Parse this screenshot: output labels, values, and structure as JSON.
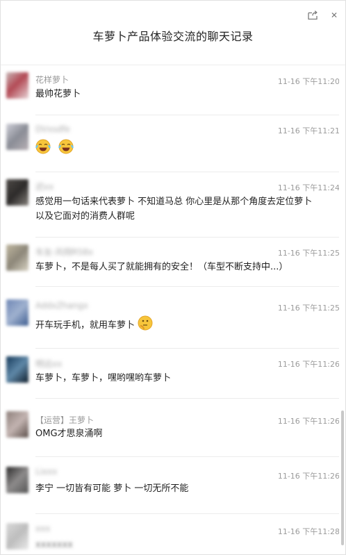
{
  "window": {
    "title": "车萝卜产品体验交流的聊天记录",
    "share_icon": "share-icon",
    "close_label": "✕"
  },
  "messages": [
    {
      "name": "花样萝卜",
      "time": "11-16 下午11:20",
      "text": "最帅花萝卜",
      "name_blur": false,
      "avatar_colors": [
        "#c8b6b6",
        "#b34a55",
        "#e7d3d6"
      ]
    },
    {
      "name": "DVxsdfe",
      "time": "11-16 下午11:21",
      "text": "",
      "emoji": [
        "laugh-cry",
        "laugh-cry"
      ],
      "name_blur": true,
      "avatar_colors": [
        "#cfcfd8",
        "#8a8d96",
        "#b7b0b5"
      ]
    },
    {
      "name": "迟xx",
      "time": "11-16 下午11:24",
      "text": "感觉用一句话来代表萝卜 不知道马总 你心里是从那个角度去定位萝卜以及它面对的消费人群呢",
      "name_blur": true,
      "avatar_colors": [
        "#4e4a47",
        "#2d2b2a",
        "#86817c"
      ]
    },
    {
      "name": "车友-风翔R58x",
      "time": "11-16 下午11:25",
      "text": "车萝卜，不是每人买了就能拥有的安全！（车型不断支持中...）",
      "name_blur": true,
      "avatar_colors": [
        "#bfb7a0",
        "#8d8779",
        "#d8d3c3"
      ]
    },
    {
      "name": "AddxZhangx",
      "time": "11-16 下午11:25",
      "text": "开车玩手机，就用车萝卜",
      "emoji_after": "thinking",
      "name_blur": true,
      "avatar_colors": [
        "#6f87b5",
        "#9fb1cf",
        "#3e5d90"
      ]
    },
    {
      "name": "明远xx",
      "time": "11-16 下午11:26",
      "text": "车萝卜，车萝卜，嘿哟嘿哟车萝卜",
      "name_blur": true,
      "avatar_colors": [
        "#163a5a",
        "#5f88a8",
        "#0f1d2b"
      ]
    },
    {
      "name": "【运营】王萝卜",
      "time": "11-16 下午11:26",
      "text": "OMG才思泉涌啊",
      "name_blur": false,
      "avatar_colors": [
        "#8d7f7a",
        "#c3b4b1",
        "#5b4e49"
      ]
    },
    {
      "name": "Lixxx",
      "time": "11-16 下午11:26",
      "text": "李宁 一切皆有可能 萝卜 一切无所不能",
      "name_blur": true,
      "avatar_colors": [
        "#2b2a2a",
        "#8d8b8b",
        "#555"
      ]
    },
    {
      "name": "xxx",
      "time": "11-16 下午11:28",
      "text": "xxxxxxx",
      "name_blur": true,
      "text_blur": true,
      "avatar_colors": [
        "#d9d9d9",
        "#bdbdbd",
        "#eaeaea"
      ]
    }
  ]
}
